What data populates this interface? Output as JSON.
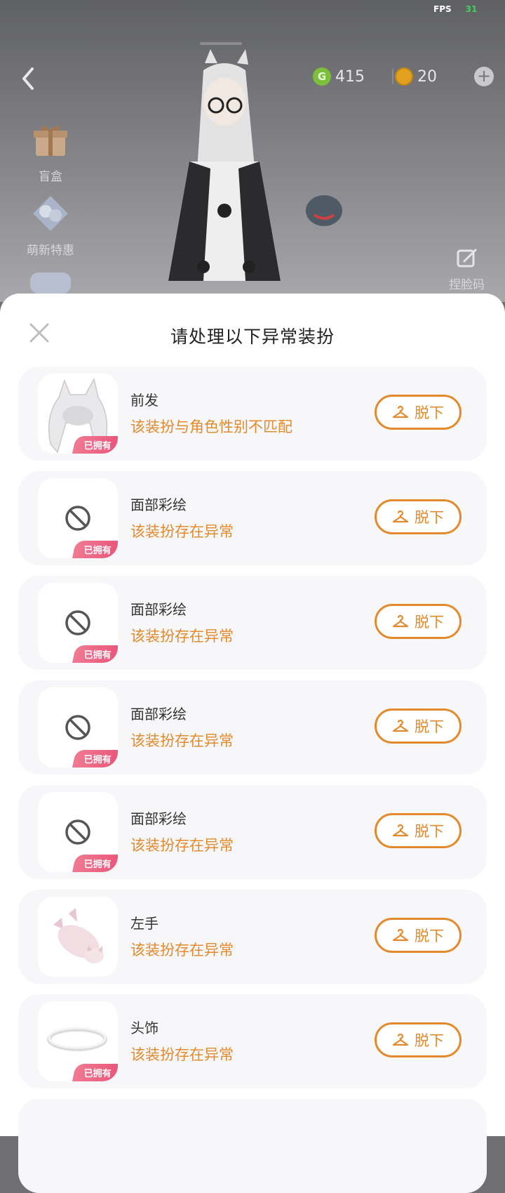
{
  "status": {
    "fps_label": "FPS",
    "fps_value": "31"
  },
  "currency": {
    "green_symbol": "G",
    "green_amount": "415",
    "gold_amount": "20",
    "plus": "+"
  },
  "side_menu": [
    {
      "label": "盲盒",
      "icon": "gift-box-icon"
    },
    {
      "label": "萌新特惠",
      "icon": "gift-pack-icon"
    }
  ],
  "pinch_face": {
    "label": "捏脸码",
    "icon": "edit-icon"
  },
  "dialog": {
    "title": "请处理以下异常装扮",
    "items": [
      {
        "name": "前发",
        "message": "该装扮与角色性别不匹配",
        "owned": "已拥有",
        "thumb": "front-hair",
        "action": "脱下"
      },
      {
        "name": "面部彩绘",
        "message": "该装扮存在异常",
        "owned": "已拥有",
        "thumb": "forbidden",
        "action": "脱下"
      },
      {
        "name": "面部彩绘",
        "message": "该装扮存在异常",
        "owned": "已拥有",
        "thumb": "forbidden",
        "action": "脱下"
      },
      {
        "name": "面部彩绘",
        "message": "该装扮存在异常",
        "owned": "已拥有",
        "thumb": "forbidden",
        "action": "脱下"
      },
      {
        "name": "面部彩绘",
        "message": "该装扮存在异常",
        "owned": "已拥有",
        "thumb": "forbidden",
        "action": "脱下"
      },
      {
        "name": "左手",
        "message": "该装扮存在异常",
        "owned": "",
        "thumb": "cat-plush",
        "action": "脱下"
      },
      {
        "name": "头饰",
        "message": "该装扮存在异常",
        "owned": "已拥有",
        "thumb": "halo-ring",
        "action": "脱下"
      }
    ]
  },
  "colors": {
    "accent": "#e48a2e",
    "owned_badge": "#e9557a",
    "card_bg": "#f7f7f9"
  }
}
